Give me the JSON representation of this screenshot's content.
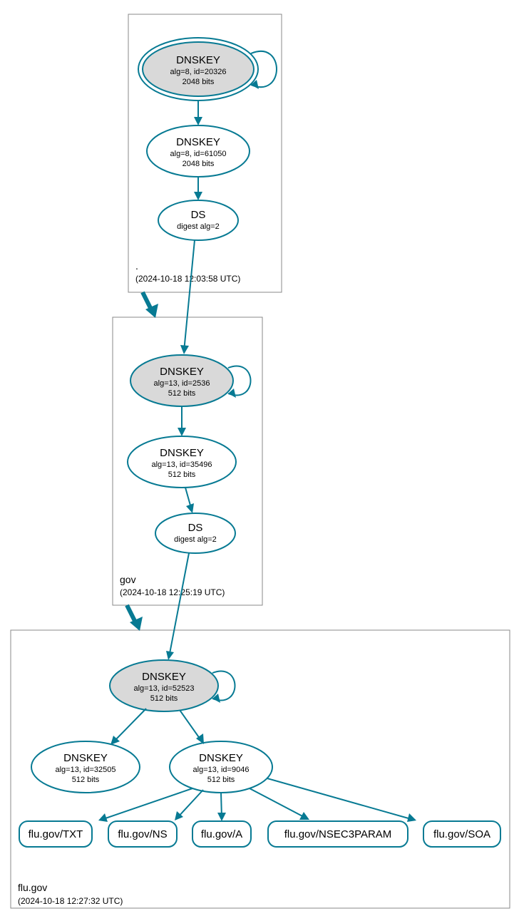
{
  "colors": {
    "accent": "#077a93",
    "grey_fill": "#d9d9d9",
    "box_stroke": "#888888"
  },
  "zones": [
    {
      "id": "root",
      "name": ".",
      "timestamp": "(2024-10-18 12:03:58 UTC)"
    },
    {
      "id": "gov",
      "name": "gov",
      "timestamp": "(2024-10-18 12:25:19 UTC)"
    },
    {
      "id": "flu_gov",
      "name": "flu.gov",
      "timestamp": "(2024-10-18 12:27:32 UTC)"
    }
  ],
  "nodes": {
    "root_ksk": {
      "title": "DNSKEY",
      "line1": "alg=8, id=20326",
      "line2": "2048 bits"
    },
    "root_zsk": {
      "title": "DNSKEY",
      "line1": "alg=8, id=61050",
      "line2": "2048 bits"
    },
    "root_ds": {
      "title": "DS",
      "line1": "digest alg=2"
    },
    "gov_ksk": {
      "title": "DNSKEY",
      "line1": "alg=13, id=2536",
      "line2": "512 bits"
    },
    "gov_zsk": {
      "title": "DNSKEY",
      "line1": "alg=13, id=35496",
      "line2": "512 bits"
    },
    "gov_ds": {
      "title": "DS",
      "line1": "digest alg=2"
    },
    "flu_ksk": {
      "title": "DNSKEY",
      "line1": "alg=13, id=52523",
      "line2": "512 bits"
    },
    "flu_zsk_a": {
      "title": "DNSKEY",
      "line1": "alg=13, id=32505",
      "line2": "512 bits"
    },
    "flu_zsk_b": {
      "title": "DNSKEY",
      "line1": "alg=13, id=9046",
      "line2": "512 bits"
    },
    "rr_txt": {
      "title": "flu.gov/TXT"
    },
    "rr_ns": {
      "title": "flu.gov/NS"
    },
    "rr_a": {
      "title": "flu.gov/A"
    },
    "rr_nsec3": {
      "title": "flu.gov/NSEC3PARAM"
    },
    "rr_soa": {
      "title": "flu.gov/SOA"
    }
  }
}
